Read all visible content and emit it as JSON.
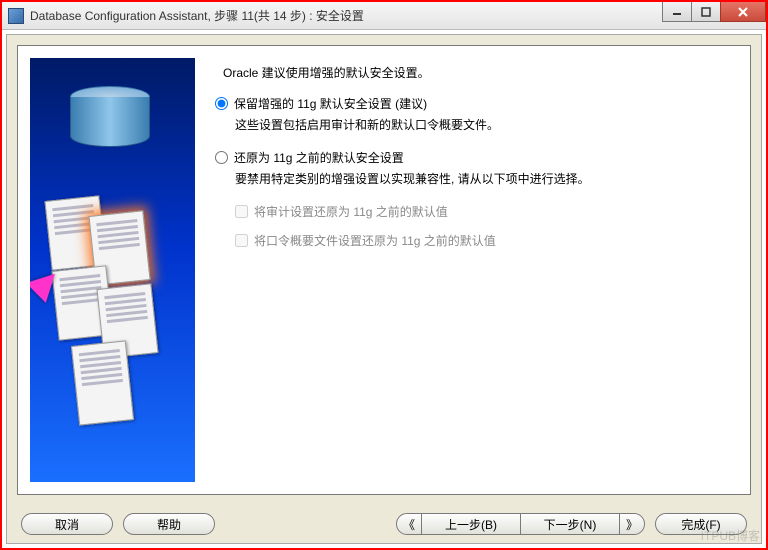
{
  "window": {
    "title": "Database Configuration Assistant, 步骤 11(共 14 步) : 安全设置"
  },
  "content": {
    "intro": "Oracle 建议使用增强的默认安全设置。",
    "option1": {
      "label": "保留增强的 11g 默认安全设置 (建议)",
      "desc": "这些设置包括启用审计和新的默认口令概要文件。"
    },
    "option2": {
      "label": "还原为 11g 之前的默认安全设置",
      "desc": "要禁用特定类别的增强设置以实现兼容性, 请从以下项中进行选择。",
      "check1": "将审计设置还原为 11g 之前的默认值",
      "check2": "将口令概要文件设置还原为 11g 之前的默认值"
    }
  },
  "buttons": {
    "cancel": "取消",
    "help": "帮助",
    "back_arrow": "《",
    "back": "上一步(B)",
    "next": "下一步(N)",
    "next_arrow": "》",
    "finish": "完成(F)"
  },
  "watermark": "ITPUB博客"
}
